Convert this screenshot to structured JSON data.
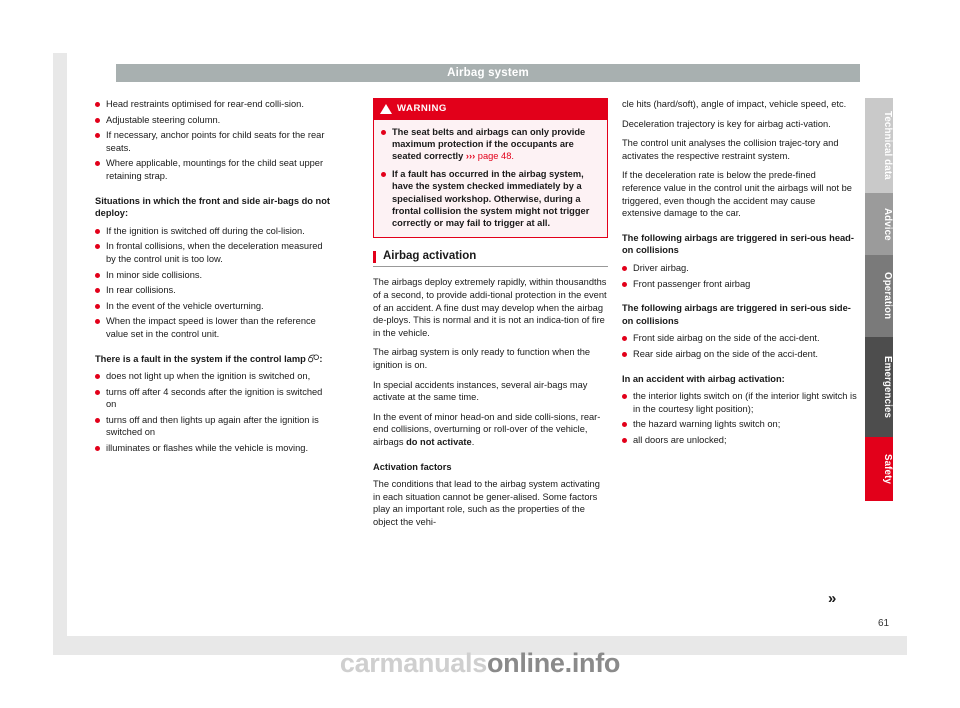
{
  "document": {
    "title": "Airbag system",
    "page_number": "61",
    "continuation_marker": "»",
    "watermark_light": "carmanuals",
    "watermark_dark": "online.info"
  },
  "side_tabs": [
    {
      "label": "Technical data",
      "color": "#c9c9c9"
    },
    {
      "label": "Advice",
      "color": "#9b9b9b"
    },
    {
      "label": "Operation",
      "color": "#7a7a7a"
    },
    {
      "label": "Emergencies",
      "color": "#4d4d4d"
    },
    {
      "label": "Safety",
      "color": "#e2001a"
    }
  ],
  "column1": {
    "bullets_top": [
      "Head restraints optimised for rear-end colli-sion.",
      "Adjustable steering column.",
      "If necessary, anchor points for child seats for the rear seats.",
      "Where applicable, mountings for the child seat upper retaining strap."
    ],
    "heading_deploy": "Situations in which the front and side air-bags do not deploy:",
    "bullets_deploy": [
      "If the ignition is switched off during the col-lision.",
      "In frontal collisions, when the deceleration measured by the control unit is too low.",
      "In minor side collisions.",
      "In rear collisions.",
      "In the event of the vehicle overturning.",
      "When the impact speed is lower than the reference value set in the control unit."
    ],
    "heading_fault": "There is a fault in the system if the control lamp ",
    "heading_fault_tail": ":",
    "bullets_fault": [
      "does not light up when the ignition is switched on,",
      "turns off after 4 seconds after the ignition is switched on",
      "turns off and then lights up again after the ignition is switched on",
      "illuminates or flashes while the vehicle is moving."
    ]
  },
  "column2": {
    "warning": {
      "label": "WARNING",
      "bullet1_bold": "The seat belts and airbags can only provide maximum protection if the occupants are seated correctly ",
      "bullet1_ref_arrow": "›››",
      "bullet1_ref_page": "page 48.",
      "bullet2": "If a fault has occurred in the airbag system, have the system checked immediately by a specialised workshop. Otherwise, during a frontal collision the system might not trigger correctly or may fail to trigger at all."
    },
    "section_heading": "Airbag activation",
    "paragraphs": [
      "The airbags deploy extremely rapidly, within thousandths of a second, to provide addi-tional protection in the event of an accident. A fine dust may develop when the airbag de-ploys. This is normal and it is not an indica-tion of fire in the vehicle.",
      "The airbag system is only ready to function when the ignition is on.",
      "In special accidents instances, several air-bags may activate at the same time."
    ],
    "paragraph_with_bold_pre": "In the event of minor head-on and side colli-sions, rear-end collisions, overturning or roll-over of the vehicle, airbags ",
    "paragraph_with_bold": "do not activate",
    "paragraph_with_bold_post": ".",
    "subheading": "Activation factors",
    "paragraph_last": "The conditions that lead to the airbag system activating in each situation cannot be gener-alised. Some factors play an important role, such as the properties of the object the vehi-"
  },
  "column3": {
    "paragraphs": [
      "cle hits (hard/soft), angle of impact, vehicle speed, etc.",
      "Deceleration trajectory is key for airbag acti-vation.",
      "The control unit analyses the collision trajec-tory and activates the respective restraint system.",
      "If the deceleration rate is below the prede-fined reference value in the control unit the airbags will not be triggered, even though the accident may cause extensive damage to the car."
    ],
    "heading_head_on": "The following airbags are triggered in seri-ous head-on collisions",
    "bullets_head_on": [
      "Driver airbag.",
      "Front passenger front airbag"
    ],
    "heading_side_on": "The following airbags are triggered in seri-ous side-on collisions",
    "bullets_side_on": [
      "Front side airbag on the side of the acci-dent.",
      "Rear side airbag on the side of the acci-dent."
    ],
    "heading_activation": "In an accident with airbag activation:",
    "bullets_activation": [
      "the interior lights switch on (if the interior light switch is in the courtesy light position);",
      "the hazard warning lights switch on;",
      "all doors are unlocked;"
    ]
  }
}
